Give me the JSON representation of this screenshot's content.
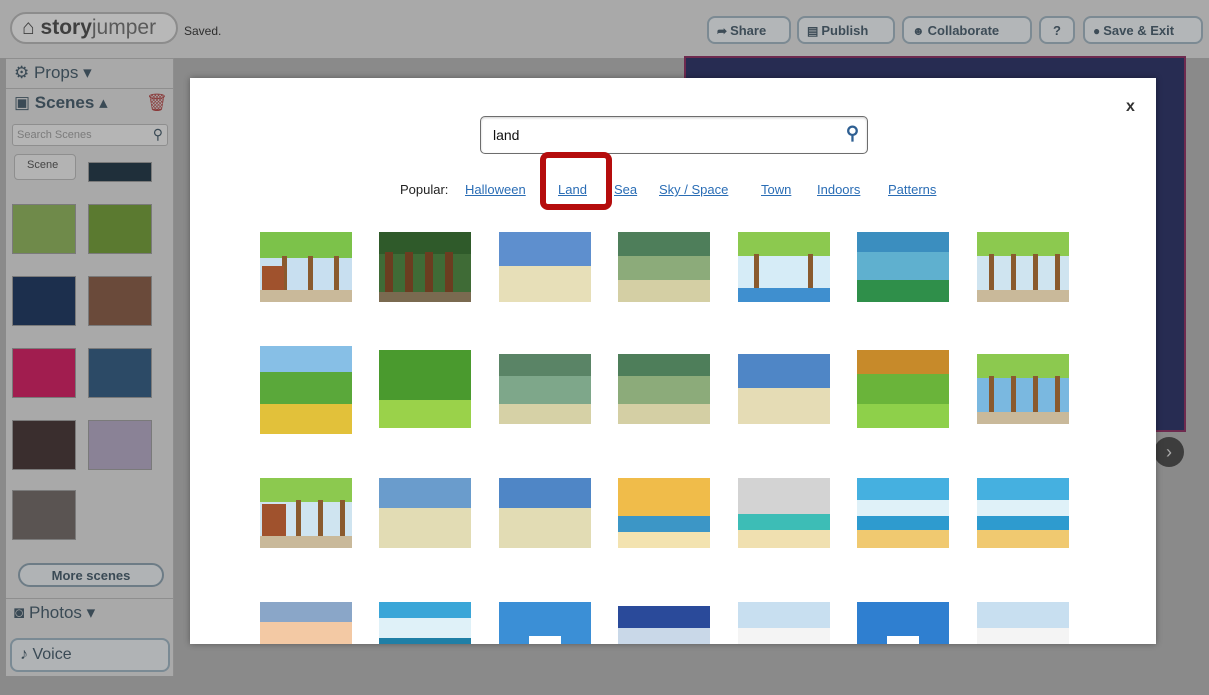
{
  "app": {
    "logo": {
      "bold": "story",
      "light": "jumper"
    },
    "status": "Saved."
  },
  "toolbar": {
    "share": "Share",
    "publish": "Publish",
    "collaborate": "Collaborate",
    "help": "?",
    "save_exit": "Save & Exit"
  },
  "sidebar": {
    "props": "Props",
    "scenes": "Scenes",
    "search_placeholder": "Search Scenes",
    "scene_tab": "Scene",
    "more_scenes": "More scenes",
    "photos": "Photos",
    "voice": "Voice"
  },
  "modal": {
    "close": "x",
    "search_value": "land",
    "popular_label": "Popular:",
    "popular_links": [
      "Halloween",
      "Land",
      "Sea",
      "Sky / Space",
      "Town",
      "Indoors",
      "Patterns"
    ],
    "highlighted_link": "Land"
  },
  "colors": {
    "link": "#2a6db5",
    "highlight": "#b50d0d",
    "toolbar_text": "#3d4c57"
  },
  "icons": {
    "share": "arrow-share-icon",
    "publish": "book-icon",
    "collaborate": "users-icon",
    "save": "disc-icon",
    "search": "search-icon",
    "props": "props-icon",
    "scenes": "image-icon",
    "photos": "camera-icon",
    "voice": "microphone-icon",
    "trash": "trash-icon"
  }
}
